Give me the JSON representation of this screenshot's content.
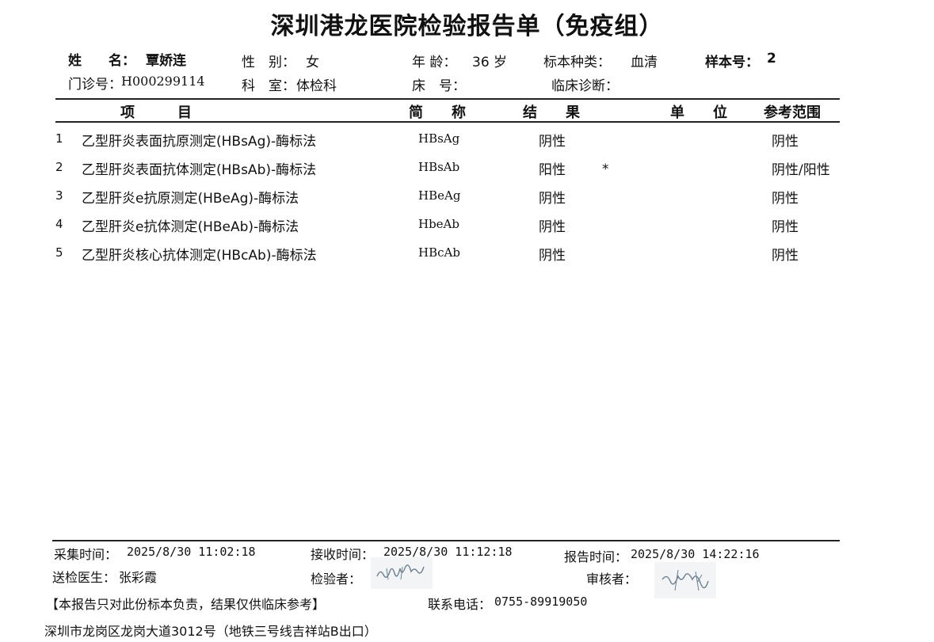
{
  "title": "深圳港龙医院检验报告单（免疫组）",
  "patient": {
    "name_label": "姓　　名：",
    "name": "覃娇连",
    "sex_label": "性　别：",
    "sex": "女",
    "age_label": "年 龄：",
    "age": "36 岁",
    "sample_type_label": "标本种类：",
    "sample_type": "血清",
    "sample_no_label": "样本号：",
    "sample_no": "2",
    "clinic_no_label": "门诊号：",
    "clinic_no": "H000299114",
    "dept_label": "科　室：",
    "dept": "体检科",
    "bed_label": "床　号：",
    "bed": "",
    "diagnosis_label": "临床诊断：",
    "diagnosis": ""
  },
  "table": {
    "headers": {
      "item": "项　　　目",
      "abbr": "简　　称",
      "result": "结　　果",
      "unit": "单　　位",
      "ref": "参考范围"
    },
    "rows": [
      {
        "no": "1",
        "item": "乙型肝炎表面抗原测定(HBsAg)-酶标法",
        "abbr": "HBsAg",
        "result": "阴性",
        "flag": "",
        "unit": "",
        "ref": "阴性"
      },
      {
        "no": "2",
        "item": "乙型肝炎表面抗体测定(HBsAb)-酶标法",
        "abbr": "HBsAb",
        "result": "阳性",
        "flag": "*",
        "unit": "",
        "ref": "阴性/阳性"
      },
      {
        "no": "3",
        "item": "乙型肝炎e抗原测定(HBeAg)-酶标法",
        "abbr": "HBeAg",
        "result": "阴性",
        "flag": "",
        "unit": "",
        "ref": "阴性"
      },
      {
        "no": "4",
        "item": "乙型肝炎e抗体测定(HBeAb)-酶标法",
        "abbr": "HbeAb",
        "result": "阴性",
        "flag": "",
        "unit": "",
        "ref": "阴性"
      },
      {
        "no": "5",
        "item": "乙型肝炎核心抗体测定(HBcAb)-酶标法",
        "abbr": "HBcAb",
        "result": "阴性",
        "flag": "",
        "unit": "",
        "ref": "阴性"
      }
    ]
  },
  "footer": {
    "collect_label": "采集时间：",
    "collect_time": "2025/8/30 11:02:18",
    "receive_label": "接收时间：",
    "receive_time": "2025/8/30 11:12:18",
    "report_label": "报告时间：",
    "report_time": "2025/8/30 14:22:16",
    "doctor_label": "送检医生：",
    "doctor": "张彩霞",
    "tester_label": "检验者：",
    "reviewer_label": "审核者：",
    "disclaimer": "【本报告只对此份标本负责，结果仅供临床参考】",
    "phone_label": "联系电话：",
    "phone": "0755-89919050",
    "address": "深圳市龙岗区龙岗大道3012号（地铁三号线吉祥站B出口）"
  },
  "colors": {
    "text": "#111111",
    "signature": "#6b7f93"
  },
  "icons": {
    "tester_signature": "handwritten-signature-icon",
    "reviewer_signature": "handwritten-signature-icon"
  }
}
